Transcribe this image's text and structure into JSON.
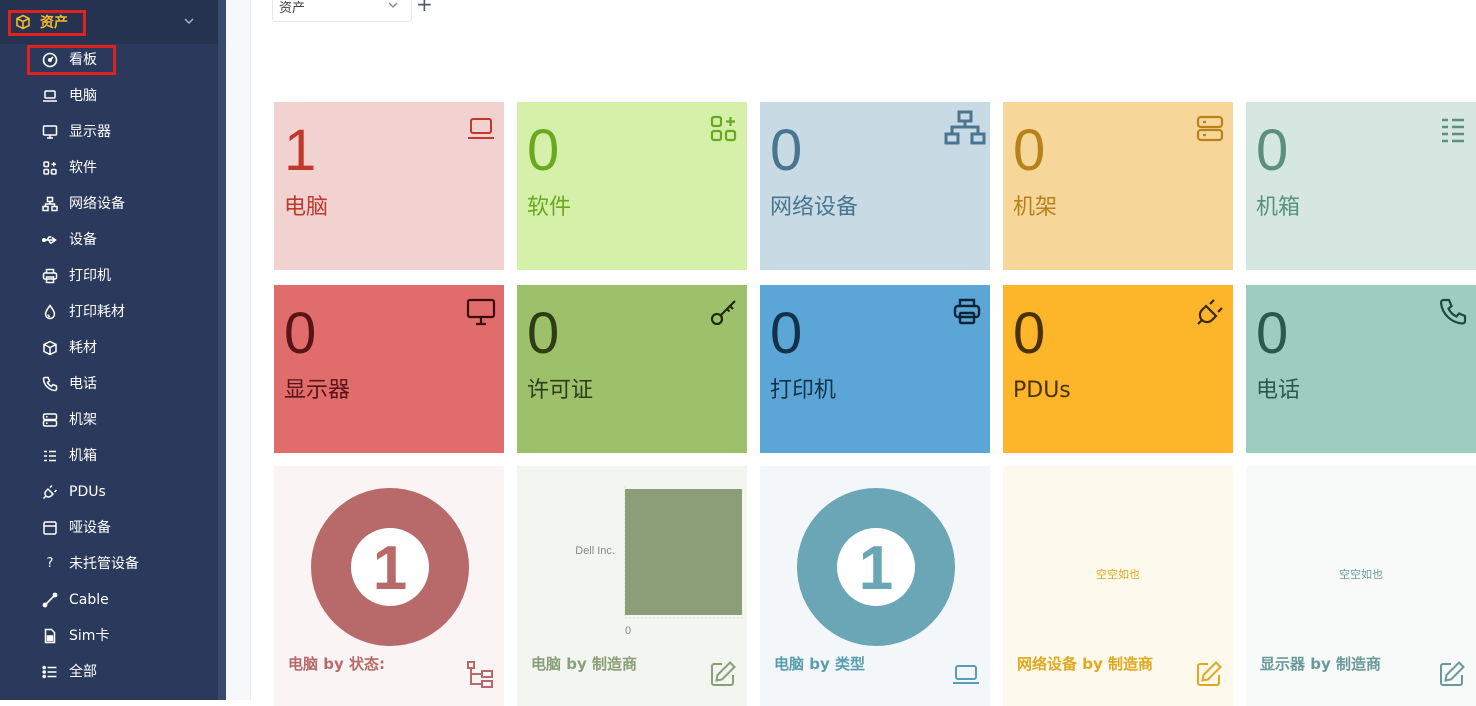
{
  "sidebar": {
    "section": {
      "label": "资产",
      "icon": "cube-icon",
      "accent": "#f5b82e"
    },
    "items": [
      {
        "label": "看板",
        "icon": "gauge-icon"
      },
      {
        "label": "电脑",
        "icon": "laptop-icon"
      },
      {
        "label": "显示器",
        "icon": "monitor-icon"
      },
      {
        "label": "软件",
        "icon": "apps-icon"
      },
      {
        "label": "网络设备",
        "icon": "network-icon"
      },
      {
        "label": "设备",
        "icon": "usb-icon"
      },
      {
        "label": "打印机",
        "icon": "printer-icon"
      },
      {
        "label": "打印耗材",
        "icon": "droplet-icon"
      },
      {
        "label": "耗材",
        "icon": "package-icon"
      },
      {
        "label": "电话",
        "icon": "phone-icon"
      },
      {
        "label": "机架",
        "icon": "server-icon"
      },
      {
        "label": "机箱",
        "icon": "list-icon"
      },
      {
        "label": "PDUs",
        "icon": "plug-icon"
      },
      {
        "label": "哑设备",
        "icon": "browser-icon"
      },
      {
        "label": "未托管设备",
        "icon": "question-icon"
      },
      {
        "label": "Cable",
        "icon": "cable-icon"
      },
      {
        "label": "Sim卡",
        "icon": "sim-icon"
      },
      {
        "label": "全部",
        "icon": "list-bullets-icon"
      }
    ]
  },
  "topbar": {
    "dashboard_select": "资产",
    "add_label": "+"
  },
  "cards_row1": [
    {
      "value": "1",
      "label": "电脑",
      "icon": "laptop-icon",
      "bg": "#f2d1d1",
      "fg": "#c0392b"
    },
    {
      "value": "0",
      "label": "软件",
      "icon": "apps-icon",
      "bg": "#d5f0a8",
      "fg": "#6aa820"
    },
    {
      "value": "0",
      "label": "网络设备",
      "icon": "network-icon",
      "bg": "#c8dbe4",
      "fg": "#4a7590"
    },
    {
      "value": "0",
      "label": "机架",
      "icon": "server-icon",
      "bg": "#f7d69a",
      "fg": "#b8821a"
    },
    {
      "value": "0",
      "label": "机箱",
      "icon": "list-icon",
      "bg": "#d6e7e2",
      "fg": "#5a9080"
    }
  ],
  "cards_row2": [
    {
      "value": "0",
      "label": "显示器",
      "icon": "monitor-icon",
      "bg": "#e06c6c",
      "fg": "#5a1414"
    },
    {
      "value": "0",
      "label": "许可证",
      "icon": "key-icon",
      "bg": "#9dc16a",
      "fg": "#2f3d14"
    },
    {
      "value": "0",
      "label": "打印机",
      "icon": "printer-icon",
      "bg": "#5ba6d6",
      "fg": "#12324a"
    },
    {
      "value": "0",
      "label": "PDUs",
      "icon": "plug-icon",
      "bg": "#fdb52a",
      "fg": "#4a3200"
    },
    {
      "value": "0",
      "label": "电话",
      "icon": "phone-icon",
      "bg": "#9ecdc0",
      "fg": "#2a5a4c"
    }
  ],
  "charts": [
    {
      "title": "电脑 by 状态:",
      "type": "pie",
      "center_value": "1",
      "icon": "sitemap-icon",
      "bg": "#faf4f4",
      "fg": "#b86a6a"
    },
    {
      "title": "电脑 by 制造商",
      "type": "bar",
      "icon": "edit-icon",
      "bg": "#f3f5f0",
      "fg": "#8a9e78",
      "bar_color": "#8c9e78",
      "category": "Dell Inc.",
      "value": 1,
      "axis_zero": "0"
    },
    {
      "title": "电脑 by 类型",
      "type": "pie",
      "center_value": "1",
      "icon": "laptop-icon",
      "bg": "#f3f7f9",
      "fg": "#5a9cb0"
    },
    {
      "title": "网络设备 by 制造商",
      "type": "empty",
      "empty_text": "空空如也",
      "icon": "edit-icon",
      "bg": "#fdf9ec",
      "fg": "#e0a820"
    },
    {
      "title": "显示器 by 制造商",
      "type": "empty",
      "empty_text": "空空如也",
      "icon": "edit-icon",
      "bg": "#f8f9f9",
      "fg": "#6a9a98"
    }
  ],
  "chart_data": [
    {
      "type": "pie",
      "title": "电脑 by 状态:",
      "values": [
        1
      ]
    },
    {
      "type": "bar",
      "title": "电脑 by 制造商",
      "categories": [
        "Dell Inc."
      ],
      "values": [
        1
      ]
    },
    {
      "type": "pie",
      "title": "电脑 by 类型",
      "values": [
        1
      ]
    }
  ]
}
